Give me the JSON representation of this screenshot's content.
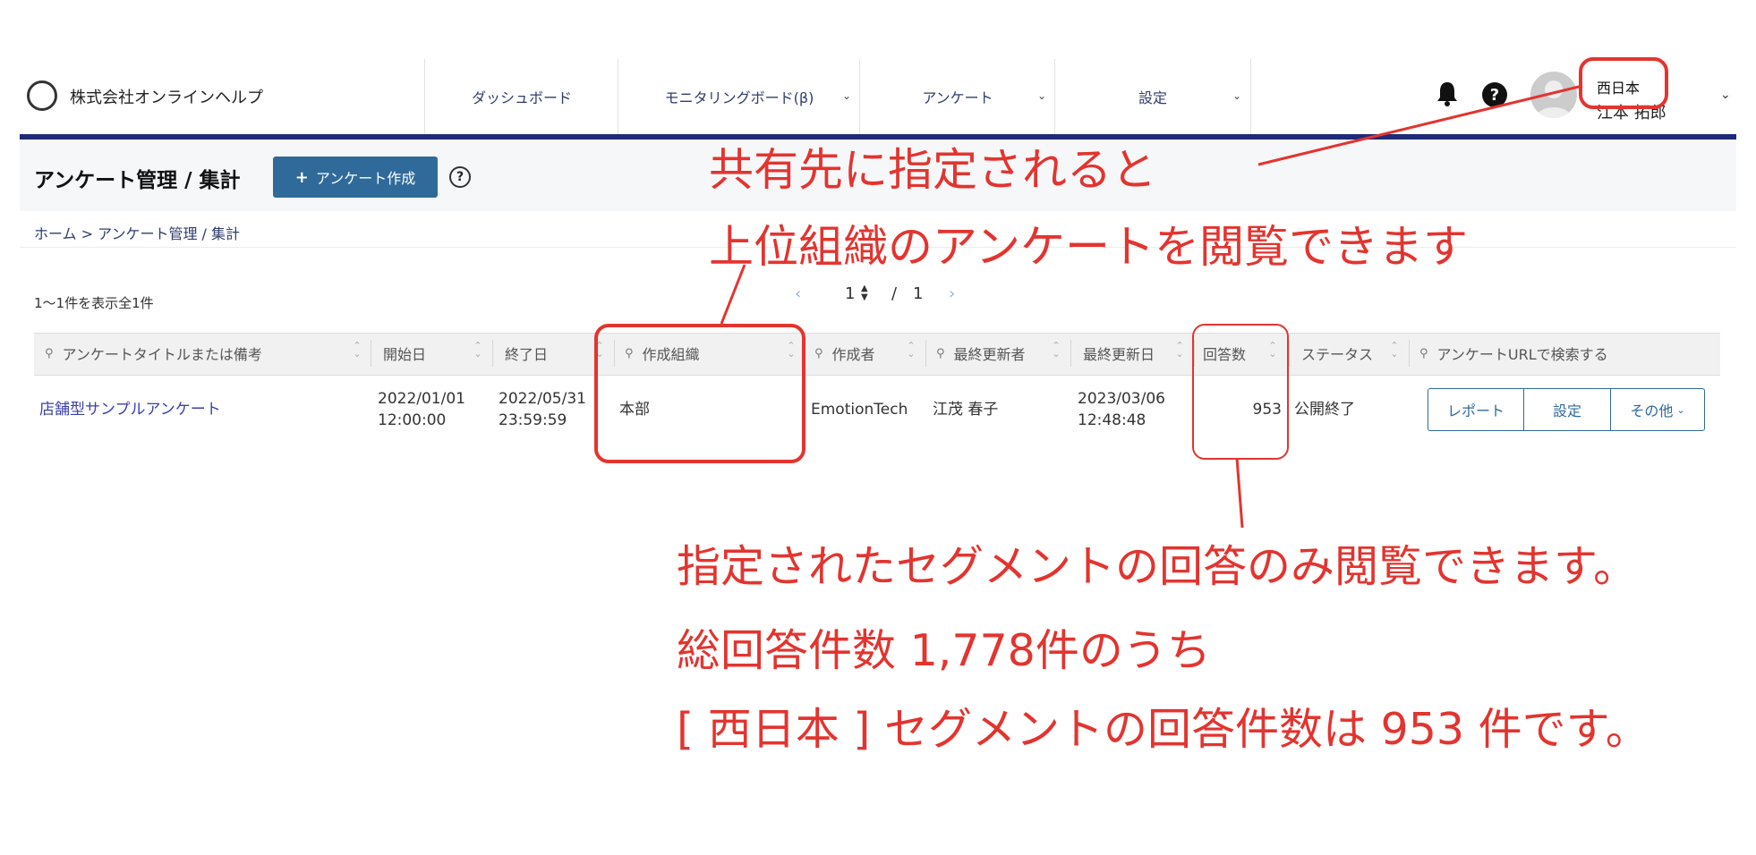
{
  "header": {
    "company": "株式会社オンラインヘルプ",
    "nav": [
      {
        "label": "ダッシュボード",
        "dropdown": false
      },
      {
        "label": "モニタリングボード(β)",
        "dropdown": true
      },
      {
        "label": "アンケート",
        "dropdown": true
      },
      {
        "label": "設定",
        "dropdown": true
      }
    ],
    "user_segment": "西日本",
    "user_name": "江本 拓郎"
  },
  "page": {
    "title": "アンケート管理 / 集計",
    "create_button": "アンケート作成",
    "breadcrumb": "ホーム > アンケート管理 / 集計",
    "count": "1〜1件を表示全1件",
    "pager": {
      "current": "1",
      "sep": "/",
      "total": "1"
    }
  },
  "table": {
    "headers": [
      "アンケートタイトルまたは備考",
      "開始日",
      "終了日",
      "作成組織",
      "作成者",
      "最終更新者",
      "最終更新日",
      "回答数",
      "ステータス",
      "アンケートURLで検索する"
    ],
    "row": {
      "title": "店舗型サンプルアンケート",
      "start_date": "2022/01/01",
      "start_time": "12:00:00",
      "end_date": "2022/05/31",
      "end_time": "23:59:59",
      "org": "本部",
      "creator": "EmotionTech",
      "updater": "江茂 春子",
      "updated_date": "2023/03/06",
      "updated_time": "12:48:48",
      "responses": "953",
      "status": "公開終了",
      "actions": [
        "レポート",
        "設定",
        "その他"
      ]
    }
  },
  "annotations": {
    "top_line1": "共有先に指定されると",
    "top_line2": "上位組織のアンケートを閲覧できます",
    "bottom_line1": "指定されたセグメントの回答のみ閲覧できます。",
    "bottom_line2": "総回答件数 1,778件のうち",
    "bottom_line3": "[ 西日本 ] セグメントの回答件数は 953 件です。",
    "color": "#e3342f"
  }
}
